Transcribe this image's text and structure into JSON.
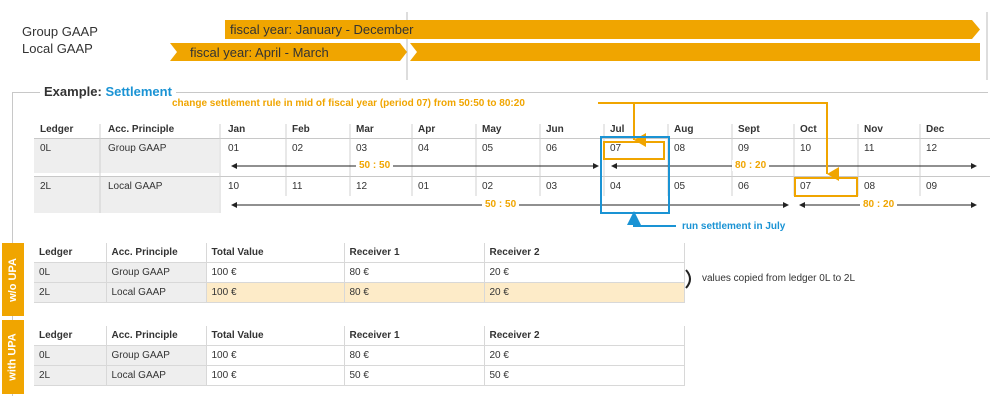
{
  "top": {
    "group_gaap": "Group GAAP",
    "local_gaap": "Local GAAP",
    "fiscal_group": "fiscal year: January - December",
    "fiscal_local": "fiscal year: April - March"
  },
  "example": {
    "label": "Example:",
    "highlight": "Settlement",
    "change_note": "change settlement rule in mid of fiscal year (period 07) from 50:50 to 80:20",
    "run_note": "run settlement in July",
    "headers": [
      "Ledger",
      "Acc. Principle",
      "Jan",
      "Feb",
      "Mar",
      "Apr",
      "May",
      "Jun",
      "Jul",
      "Aug",
      "Sept",
      "Oct",
      "Nov",
      "Dec"
    ],
    "rows": [
      {
        "ledger": "0L",
        "principle": "Group GAAP",
        "periods": [
          "01",
          "02",
          "03",
          "04",
          "05",
          "06",
          "07",
          "08",
          "09",
          "10",
          "11",
          "12"
        ]
      },
      {
        "ledger": "2L",
        "principle": "Local GAAP",
        "periods": [
          "10",
          "11",
          "12",
          "01",
          "02",
          "03",
          "04",
          "05",
          "06",
          "07",
          "08",
          "09"
        ]
      }
    ],
    "ratio_5050": "50 : 50",
    "ratio_8020": "80 : 20"
  },
  "wo_upa": {
    "tab": "w/o UPA",
    "headers": [
      "Ledger",
      "Acc. Principle",
      "Total Value",
      "Receiver 1",
      "Receiver 2"
    ],
    "rows": [
      [
        "0L",
        "Group GAAP",
        "100 €",
        "80 €",
        "20 €"
      ],
      [
        "2L",
        "Local GAAP",
        "100 €",
        "80 €",
        "20 €"
      ]
    ],
    "note": "values copied from ledger 0L to 2L"
  },
  "with_upa": {
    "tab": "with UPA",
    "headers": [
      "Ledger",
      "Acc. Principle",
      "Total Value",
      "Receiver 1",
      "Receiver 2"
    ],
    "rows": [
      [
        "0L",
        "Group GAAP",
        "100 €",
        "80 €",
        "20 €"
      ],
      [
        "2L",
        "Local GAAP",
        "100 €",
        "50 €",
        "50 €"
      ]
    ]
  },
  "colors": {
    "orange": "#f0a500",
    "blue": "#1a93d4",
    "highlight_row": "#fdebc8",
    "gray_band": "#eeeeee"
  }
}
